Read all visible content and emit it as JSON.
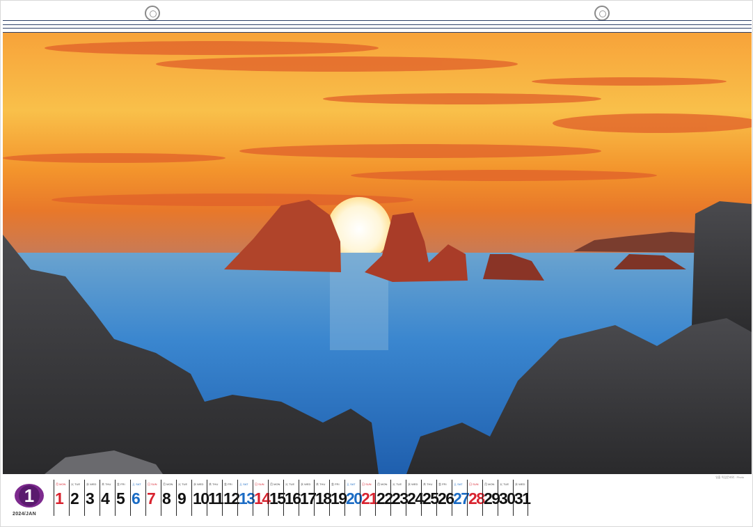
{
  "calendar": {
    "month_number": "1",
    "year_month_label": "2024/JAN",
    "credit": "일출 독립문바위 · Photo",
    "days": [
      {
        "num": "1",
        "dow": "月 MON",
        "type": "holiday"
      },
      {
        "num": "2",
        "dow": "火 TUE",
        "type": "weekday"
      },
      {
        "num": "3",
        "dow": "水 WED",
        "type": "weekday"
      },
      {
        "num": "4",
        "dow": "木 THU",
        "type": "weekday"
      },
      {
        "num": "5",
        "dow": "金 FRI",
        "type": "weekday"
      },
      {
        "num": "6",
        "dow": "土 SAT",
        "type": "sat"
      },
      {
        "num": "7",
        "dow": "日 SUN",
        "type": "sun"
      },
      {
        "num": "8",
        "dow": "月 MON",
        "type": "weekday"
      },
      {
        "num": "9",
        "dow": "火 TUE",
        "type": "weekday"
      },
      {
        "num": "10",
        "dow": "水 WED",
        "type": "weekday"
      },
      {
        "num": "11",
        "dow": "木 THU",
        "type": "weekday"
      },
      {
        "num": "12",
        "dow": "金 FRI",
        "type": "weekday"
      },
      {
        "num": "13",
        "dow": "土 SAT",
        "type": "sat"
      },
      {
        "num": "14",
        "dow": "日 SUN",
        "type": "sun"
      },
      {
        "num": "15",
        "dow": "月 MON",
        "type": "weekday"
      },
      {
        "num": "16",
        "dow": "火 TUE",
        "type": "weekday"
      },
      {
        "num": "17",
        "dow": "水 WED",
        "type": "weekday"
      },
      {
        "num": "18",
        "dow": "木 THU",
        "type": "weekday"
      },
      {
        "num": "19",
        "dow": "金 FRI",
        "type": "weekday"
      },
      {
        "num": "20",
        "dow": "土 SAT",
        "type": "sat"
      },
      {
        "num": "21",
        "dow": "日 SUN",
        "type": "sun"
      },
      {
        "num": "22",
        "dow": "月 MON",
        "type": "weekday"
      },
      {
        "num": "23",
        "dow": "火 TUE",
        "type": "weekday"
      },
      {
        "num": "24",
        "dow": "水 WED",
        "type": "weekday"
      },
      {
        "num": "25",
        "dow": "木 THU",
        "type": "weekday"
      },
      {
        "num": "26",
        "dow": "金 FRI",
        "type": "weekday"
      },
      {
        "num": "27",
        "dow": "土 SAT",
        "type": "sat"
      },
      {
        "num": "28",
        "dow": "日 SUN",
        "type": "sun"
      },
      {
        "num": "29",
        "dow": "月 MON",
        "type": "weekday"
      },
      {
        "num": "30",
        "dow": "火 TUE",
        "type": "weekday"
      },
      {
        "num": "31",
        "dow": "水 WED",
        "type": "weekday"
      }
    ]
  },
  "colors": {
    "month_badge": "#7d2a8e",
    "saturday": "#1a6bc4",
    "sunday": "#d8222e",
    "sky_top": "#f08a2a",
    "sea": "#2f74c0"
  },
  "photo": {
    "scene": "sunrise-sea-rocks"
  }
}
